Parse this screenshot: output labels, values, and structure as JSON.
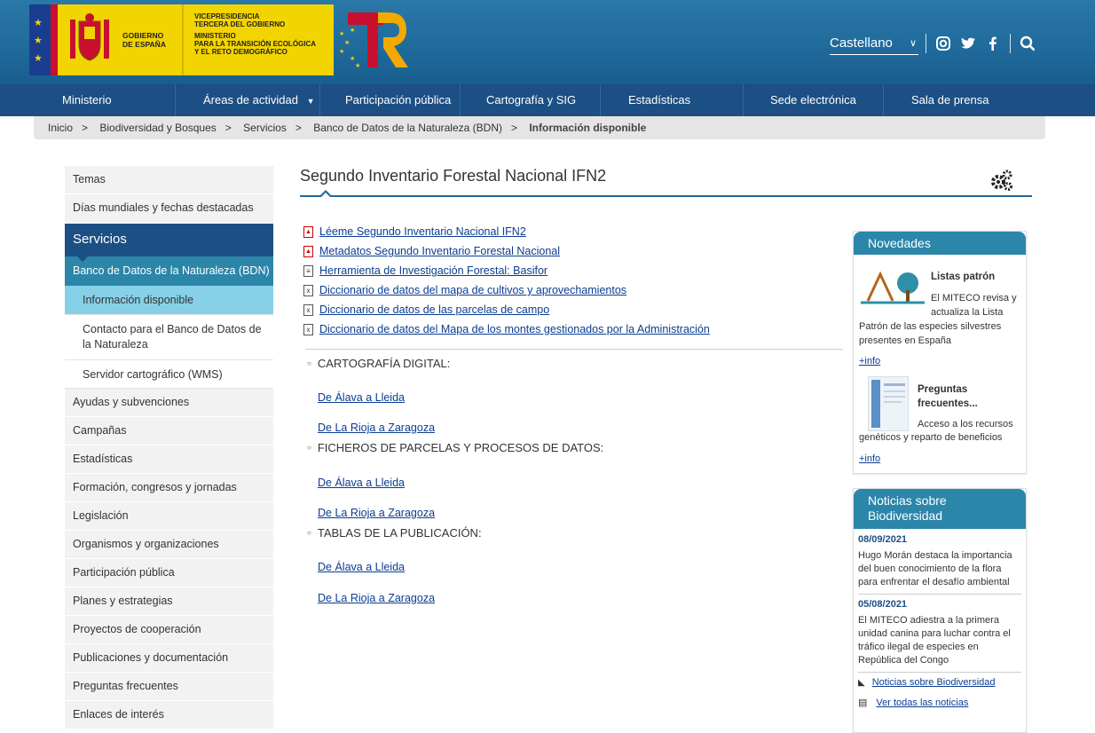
{
  "header": {
    "gob_line1": "GOBIERNO",
    "gob_line2": "DE ESPAÑA",
    "vice_line1": "VICEPRESIDENCIA",
    "vice_line2": "TERCERA DEL GOBIERNO",
    "min_line1": "MINISTERIO",
    "min_line2": "PARA LA TRANSICIÓN ECOLÓGICA",
    "min_line3": "Y EL RETO DEMOGRÁFICO",
    "language": "Castellano"
  },
  "nav": [
    "Ministerio",
    "Áreas de actividad",
    "Participación pública",
    "Cartografía y SIG",
    "Estadísticas",
    "Sede electrónica",
    "Sala de prensa"
  ],
  "breadcrumb": [
    "Inicio",
    "Biodiversidad y Bosques",
    "Servicios",
    "Banco de Datos de la Naturaleza (BDN)",
    "Información disponible"
  ],
  "sidebar": {
    "top": [
      "Temas",
      "Días mundiales y fechas destacadas"
    ],
    "servicios": "Servicios",
    "bdn": "Banco de Datos de la Naturaleza (BDN)",
    "sub": [
      "Información disponible",
      "Contacto para el Banco de Datos de la Naturaleza",
      "Servidor cartográfico (WMS)"
    ],
    "rest": [
      "Ayudas y subvenciones",
      "Campañas",
      "Estadísticas",
      "Formación, congresos y jornadas",
      "Legislación",
      "Organismos y organizaciones",
      "Participación pública",
      "Planes y estrategias",
      "Proyectos de cooperación",
      "Publicaciones y documentación",
      "Preguntas frecuentes",
      "Enlaces de interés"
    ]
  },
  "main": {
    "title": "Segundo Inventario Forestal Nacional IFN2",
    "docs": [
      {
        "type": "pdf",
        "label": "Léeme Segundo Inventario Nacional IFN2"
      },
      {
        "type": "pdf",
        "label": "Metadatos Segundo Inventario Forestal Nacional"
      },
      {
        "type": "xls",
        "label": "Herramienta de Investigación Forestal: Basifor"
      },
      {
        "type": "xls",
        "label": "Diccionario de datos del mapa de cultivos y aprovechamientos"
      },
      {
        "type": "xls",
        "label": "Diccionario de datos de las parcelas de campo"
      },
      {
        "type": "xls",
        "label": "Diccionario de datos del Mapa de los montes gestionados por la Administración"
      }
    ],
    "sections": [
      {
        "title": "CARTOGRAFÍA DIGITAL:",
        "links": [
          "De Álava a Lleida",
          "De La Rioja a Zaragoza"
        ]
      },
      {
        "title": "FICHEROS DE PARCELAS Y PROCESOS DE DATOS:",
        "links": [
          "De Álava a Lleida",
          "De La Rioja a Zaragoza"
        ]
      },
      {
        "title": "TABLAS DE LA PUBLICACIÓN:",
        "links": [
          "De Álava a Lleida",
          "De La Rioja a Zaragoza"
        ]
      }
    ]
  },
  "novedades": {
    "title": "Novedades",
    "items": [
      {
        "heading": "Listas patrón",
        "text_right": "El MITECO revisa y actualiza la Lista",
        "text_full": "Patrón de las especies silvestres presentes en España",
        "more": "+info"
      },
      {
        "heading": "Preguntas frecuentes...",
        "text_right": "Acceso a los recursos",
        "text_full": "genéticos y reparto de beneficios",
        "more": "+info"
      }
    ]
  },
  "noticias": {
    "title": "Noticias sobre Biodiversidad",
    "items": [
      {
        "date": "08/09/2021",
        "text": "Hugo Morán destaca la importancia del buen conocimiento de la flora para enfrentar el desafío ambiental"
      },
      {
        "date": "05/08/2021",
        "text": "El MITECO adiestra a la primera unidad canina para luchar contra el tráfico ilegal de especies en República del Congo"
      }
    ],
    "rss_link": "Noticias sobre Biodiversidad",
    "all_link": "Ver todas las noticias"
  }
}
